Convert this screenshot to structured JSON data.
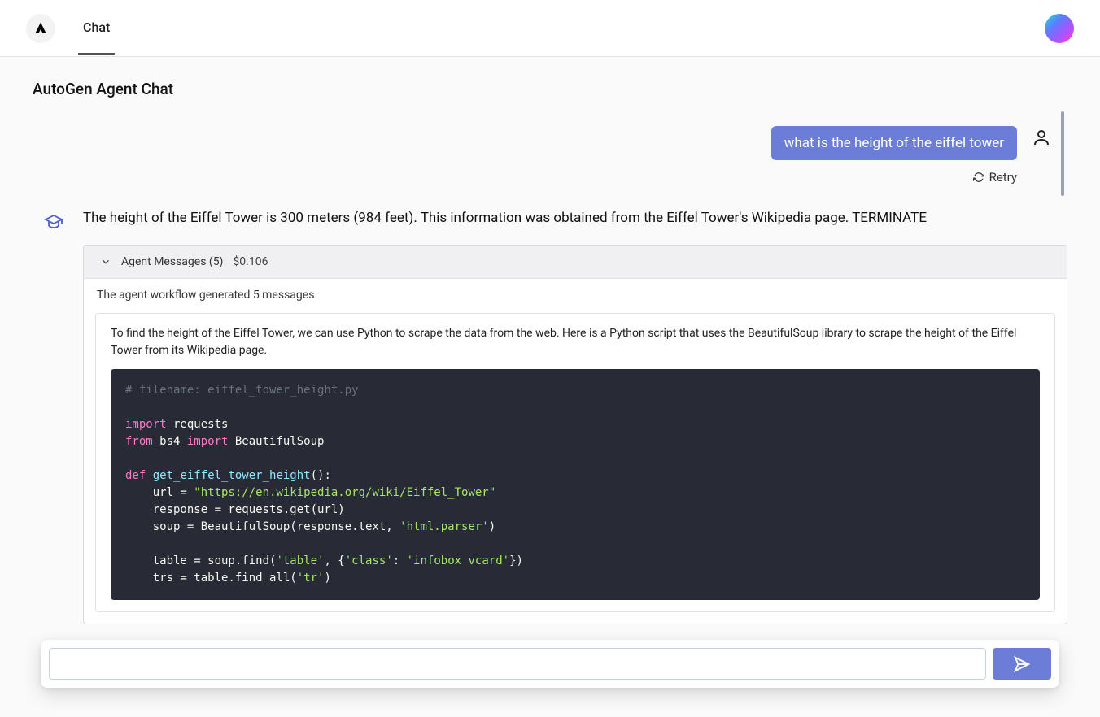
{
  "header": {
    "tab": "Chat"
  },
  "page": {
    "title": "AutoGen Agent Chat"
  },
  "conversation": {
    "user_message": "what is the height of the eiffel tower",
    "retry_label": "Retry",
    "assistant_message": "The height of the Eiffel Tower is 300 meters (984 feet). This information was obtained from the Eiffel Tower's Wikipedia page. TERMINATE"
  },
  "panel": {
    "header_label": "Agent Messages (5)",
    "cost": "$0.106",
    "subtext": "The agent workflow generated 5 messages",
    "card_text": "To find the height of the Eiffel Tower, we can use Python to scrape the data from the web. Here is a Python script that uses the BeautifulSoup library to scrape the height of the Eiffel Tower from its Wikipedia page.",
    "code": {
      "l1": "# filename: eiffel_tower_height.py",
      "l2a": "import",
      "l2b": " requests",
      "l3a": "from",
      "l3b": " bs4 ",
      "l3c": "import",
      "l3d": " BeautifulSoup",
      "l4a": "def",
      "l4b": " ",
      "l4c": "get_eiffel_tower_height",
      "l4d": "():",
      "l5a": "    url = ",
      "l5b": "\"https://en.wikipedia.org/wiki/Eiffel_Tower\"",
      "l6": "    response = requests.get(url)",
      "l7a": "    soup = BeautifulSoup(response.text, ",
      "l7b": "'html.parser'",
      "l7c": ")",
      "l8a": "    table = soup.find(",
      "l8b": "'table'",
      "l8c": ", {",
      "l8d": "'class'",
      "l8e": ": ",
      "l8f": "'infobox vcard'",
      "l8g": "})",
      "l9a": "    trs = table.find_all(",
      "l9b": "'tr'",
      "l9c": ")"
    }
  },
  "input": {
    "placeholder": "",
    "value": ""
  }
}
